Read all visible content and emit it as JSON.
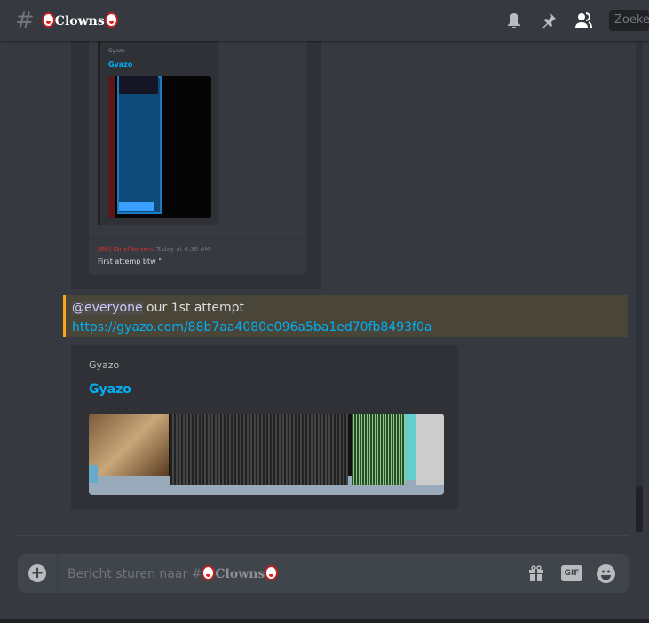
{
  "header": {
    "channel_name": "Clowns",
    "search_placeholder": "Zoeken"
  },
  "old_screenshot": {
    "embed_provider": "Gyazo",
    "embed_title": "Gyazo",
    "author": "[EU] iGriefServers",
    "timestamp": "Today at 6:36 AM",
    "text": "First attemp btw \""
  },
  "message": {
    "mention": "@everyone",
    "text": " our 1st attempt",
    "link": "https://gyazo.com/88b7aa4080e096a5ba1ed70fb8493f0a"
  },
  "embed": {
    "provider": "Gyazo",
    "title": "Gyazo"
  },
  "composer": {
    "placeholder_prefix": "Bericht sturen naar #",
    "channel_name": "Clowns",
    "gif_label": "GIF"
  },
  "colors": {
    "accent_link": "#00b0f4",
    "mention_border": "#faa61a",
    "background": "#36393f"
  }
}
